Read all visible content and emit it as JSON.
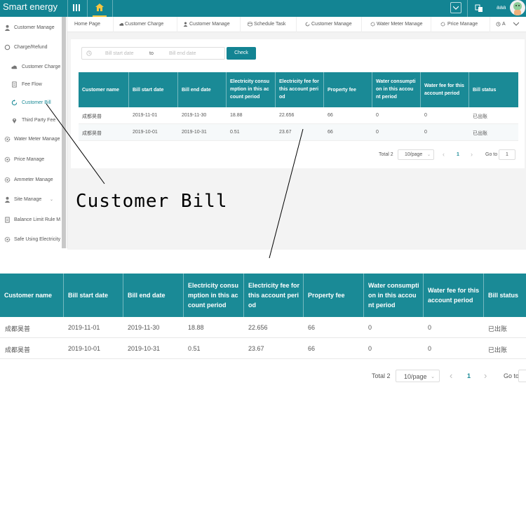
{
  "app": {
    "title": "Smart energy",
    "user": "aaa"
  },
  "sidebar": {
    "items": [
      {
        "label": "Customer Manage",
        "icon": "user-icon"
      },
      {
        "label": "Charge/Refund",
        "icon": "circle-icon"
      },
      {
        "label": "Customer Charge",
        "icon": "cloud-icon"
      },
      {
        "label": "Fee Flow",
        "icon": "document-icon"
      },
      {
        "label": "Customer Bill",
        "icon": "refresh-icon"
      },
      {
        "label": "Third Party Fee",
        "icon": "location-pin-icon"
      },
      {
        "label": "Water Meter Manage",
        "icon": "gear-icon"
      },
      {
        "label": "Price Manage",
        "icon": "gear-icon"
      },
      {
        "label": "Ammeter Manage",
        "icon": "gear-icon"
      },
      {
        "label": "Site Manage",
        "icon": "user-icon"
      },
      {
        "label": "Balance Limit Rule M",
        "icon": "document-icon"
      },
      {
        "label": "Safe Using Electricity",
        "icon": "gear-icon"
      }
    ]
  },
  "tabs": [
    {
      "label": "Home Page",
      "icon": ""
    },
    {
      "label": "Customer Charge",
      "icon": "cloud-icon"
    },
    {
      "label": "Customer Manage",
      "icon": "user-icon"
    },
    {
      "label": "Schedule Task",
      "icon": "database-icon"
    },
    {
      "label": "Customer Manage",
      "icon": "refresh-icon"
    },
    {
      "label": "Water Meter Manage",
      "icon": "gear-icon"
    },
    {
      "label": "Price Manage",
      "icon": "gear-icon"
    },
    {
      "label": "A",
      "icon": "clock-icon"
    }
  ],
  "filter": {
    "start_placeholder": "Bill start date",
    "separator": "to",
    "end_placeholder": "Bill end date",
    "check_label": "Check"
  },
  "table": {
    "columns": [
      "Customer name",
      "Bill start date",
      "Bill end date",
      "Electricity consumption in this account period",
      "Electricity fee for this account period",
      "Property fee",
      "Water consumption in this account period",
      "Water fee for this account period",
      "Bill status"
    ],
    "columns_small": [
      "Customer name",
      "Bill start date",
      "Bill end date",
      "Electricity consu mption in this ac count period",
      "Electricity fee for this account peri od",
      "Property fee",
      "Water consumpti on in this accou nt period",
      "Water fee for this account period",
      "Bill status"
    ],
    "columns_large": [
      "Customer name",
      "Bill start date",
      "Bill end date",
      "Electricity consu mption in this ac count period",
      "Electricity fee for this account peri od",
      "Property fee",
      "Water consumpti on in this accou nt period",
      "Water fee for this account period",
      "Bill status"
    ],
    "rows": [
      [
        "成都昊普",
        "2019-11-01",
        "2019-11-30",
        "18.88",
        "22.656",
        "66",
        "0",
        "0",
        "已出账"
      ],
      [
        "成都昊普",
        "2019-10-01",
        "2019-10-31",
        "0.51",
        "23.67",
        "66",
        "0",
        "0",
        "已出账"
      ]
    ]
  },
  "pagination": {
    "total": "Total 2",
    "page_size": "10/page",
    "prev": "‹",
    "current": "1",
    "next": "›",
    "goto_label": "Go to",
    "goto_value": "1"
  },
  "annotation": {
    "callout": "Customer Bill"
  },
  "colors": {
    "primary": "#138493",
    "header": "#1a8a96",
    "active_tab": "#f5c542"
  }
}
